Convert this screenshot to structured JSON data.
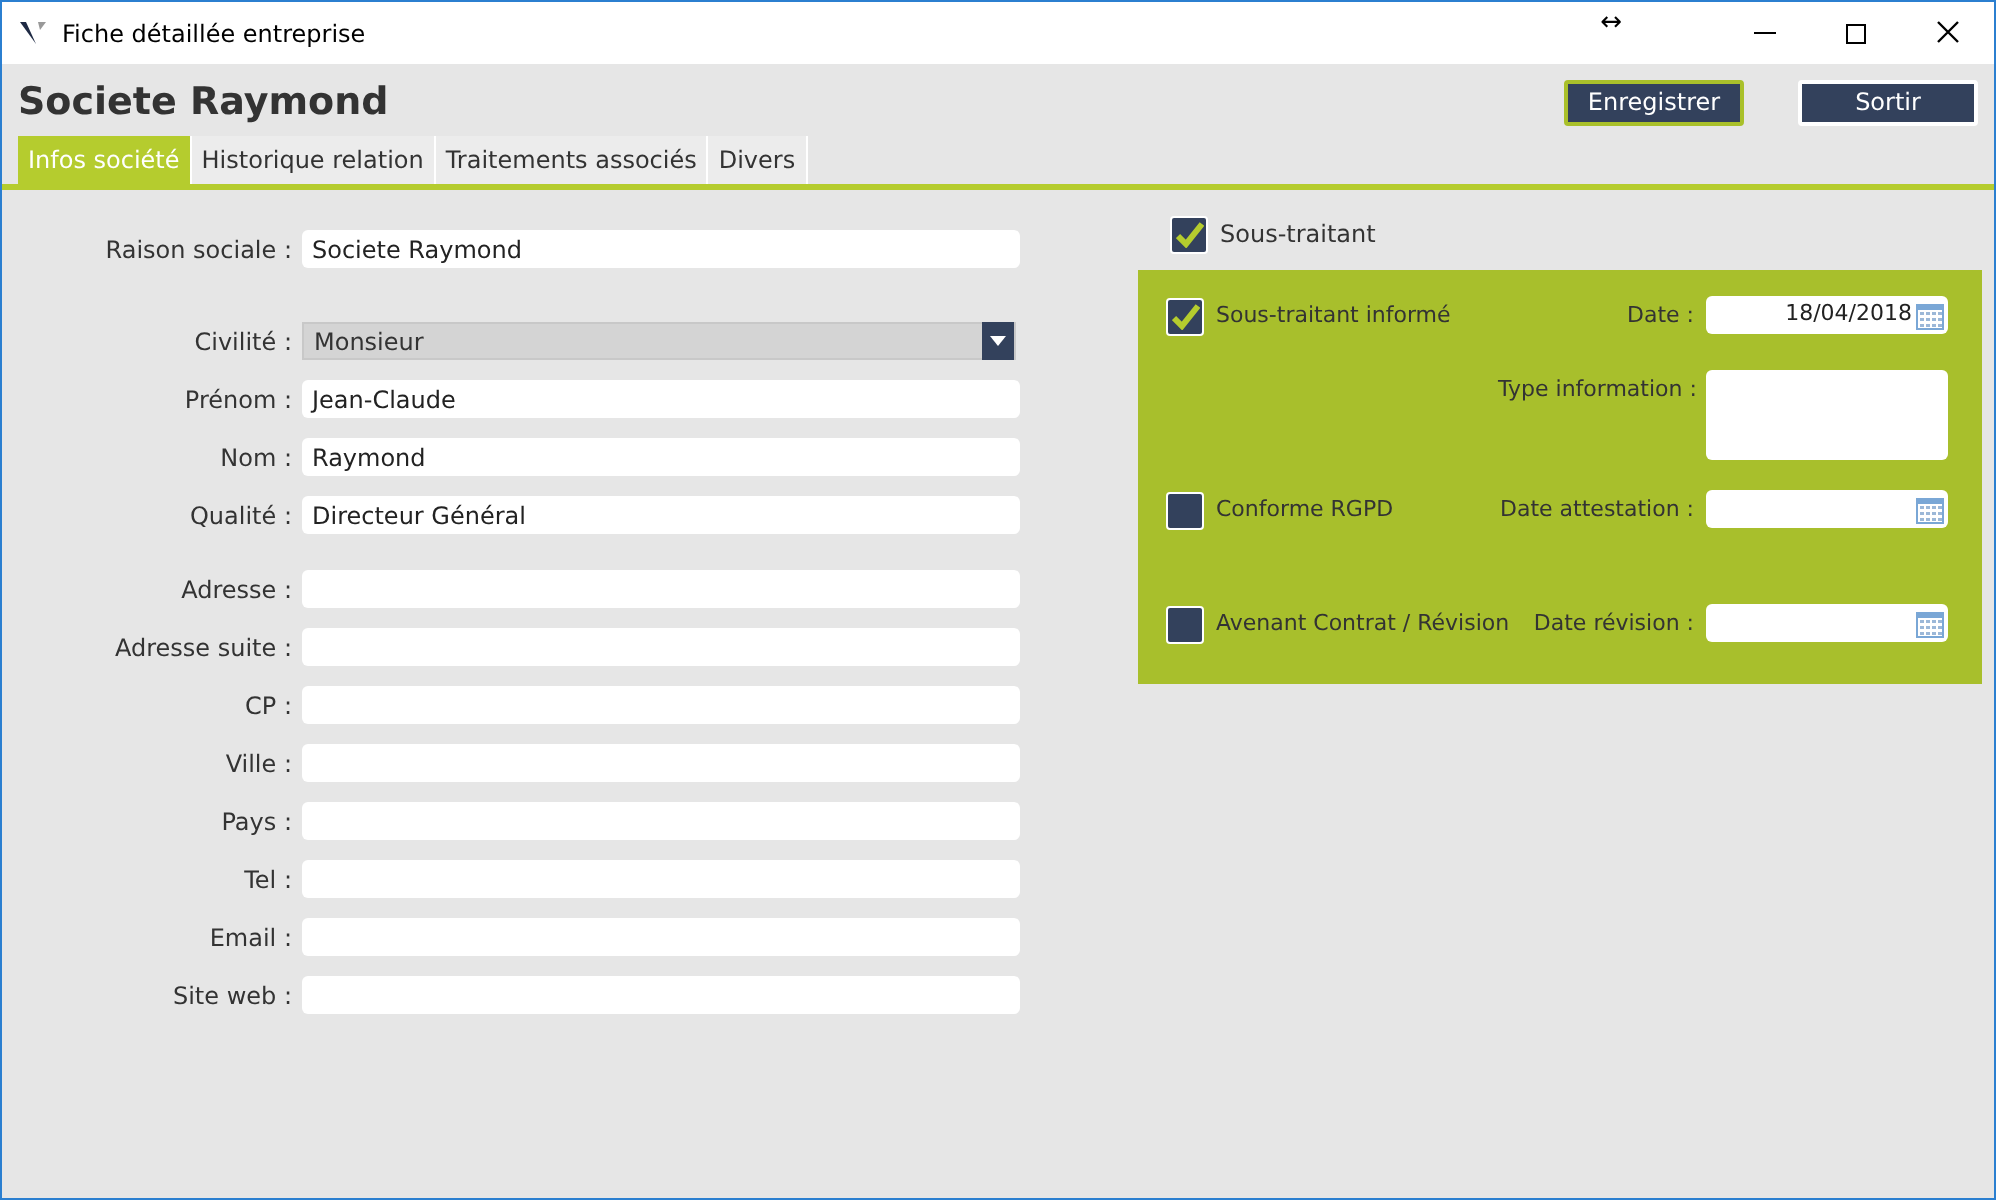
{
  "window": {
    "title": "Fiche détaillée entreprise",
    "controls": [
      "↔"
    ]
  },
  "header": {
    "title": "Societe Raymond",
    "buttons": [
      {
        "label": "Enregistrer",
        "selected": true
      },
      {
        "label": "Sortir",
        "selected": false
      }
    ]
  },
  "tabs": [
    {
      "label": "Infos société",
      "selected": true
    },
    {
      "label": "Historique relation",
      "selected": false
    },
    {
      "label": "Traitements associés",
      "selected": false
    },
    {
      "label": "Divers",
      "selected": false
    }
  ],
  "form": {
    "sections": [
      [
        {
          "label": "Raison sociale :",
          "value": "Societe Raymond",
          "kind": "text"
        }
      ],
      [
        {
          "label": "Civilité :",
          "value": "Monsieur",
          "kind": "select"
        },
        {
          "label": "Prénom :",
          "value": "Jean-Claude",
          "kind": "text"
        },
        {
          "label": "Nom :",
          "value": "Raymond",
          "kind": "text"
        },
        {
          "label": "Qualité :",
          "value": "Directeur Général",
          "kind": "text"
        }
      ],
      [
        {
          "label": "Adresse :",
          "kind": "text"
        },
        {
          "label": "Adresse suite :",
          "kind": "text"
        },
        {
          "label": "CP :",
          "kind": "text"
        },
        {
          "label": "Ville :",
          "kind": "text"
        },
        {
          "label": "Pays :",
          "kind": "text"
        },
        {
          "label": "Tel :",
          "kind": "text"
        },
        {
          "label": "Email :",
          "kind": "text"
        },
        {
          "label": "Site web :",
          "kind": "text"
        }
      ]
    ]
  },
  "subcontractor": {
    "label": "Sous-traitant",
    "checked": true
  },
  "panel": {
    "rows": [
      {
        "checkbox": {
          "label": "Sous-traitant informé",
          "checked": true
        },
        "field": {
          "label": "Date :",
          "value": "18/04/2018",
          "kind": "date"
        }
      },
      {
        "field": {
          "label": "Type information :",
          "kind": "textarea"
        }
      },
      {
        "checkbox": {
          "label": "Conforme RGPD",
          "checked": false
        },
        "field": {
          "label": "Date attestation :",
          "kind": "date"
        }
      },
      {
        "checkbox": {
          "label": "Avenant Contrat / Révision",
          "checked": false
        },
        "field": {
          "label": "Date révision :",
          "kind": "date"
        }
      }
    ]
  }
}
